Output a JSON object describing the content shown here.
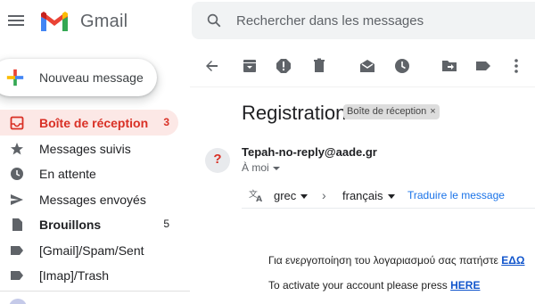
{
  "app": {
    "name": "Gmail"
  },
  "search": {
    "placeholder": "Rechercher dans les messages"
  },
  "compose": {
    "label": "Nouveau message"
  },
  "sidebar": {
    "items": [
      {
        "label": "Boîte de réception",
        "count": "3",
        "icon": "inbox-icon"
      },
      {
        "label": "Messages suivis",
        "count": "",
        "icon": "star-icon"
      },
      {
        "label": "En attente",
        "count": "",
        "icon": "clock-icon"
      },
      {
        "label": "Messages envoyés",
        "count": "",
        "icon": "send-icon"
      },
      {
        "label": "Brouillons",
        "count": "5",
        "icon": "draft-icon"
      },
      {
        "label": "[Gmail]/Spam/Sent",
        "count": "",
        "icon": "label-icon"
      },
      {
        "label": "[Imap]/Trash",
        "count": "",
        "icon": "label-icon"
      }
    ]
  },
  "message": {
    "subject": "Registration",
    "label_chip": "Boîte de réception",
    "label_chip_close": "×",
    "sender_initial": "?",
    "sender": "Tepah-no-reply@aade.gr",
    "recipient": "À moi",
    "translate": {
      "from_lang": "grec",
      "to_lang": "français",
      "arrow": "›",
      "action": "Traduire le message"
    },
    "body": {
      "line1_text": "Για ενεργοποίηση του λογαριασμού σας πατήστε ",
      "line1_link": "ΕΔΩ",
      "line2_text": "To activate your account please press ",
      "line2_link": "HERE"
    }
  },
  "colors": {
    "accent": "#d93025",
    "active_bg": "#fce8e6",
    "link": "#1a73e8"
  }
}
